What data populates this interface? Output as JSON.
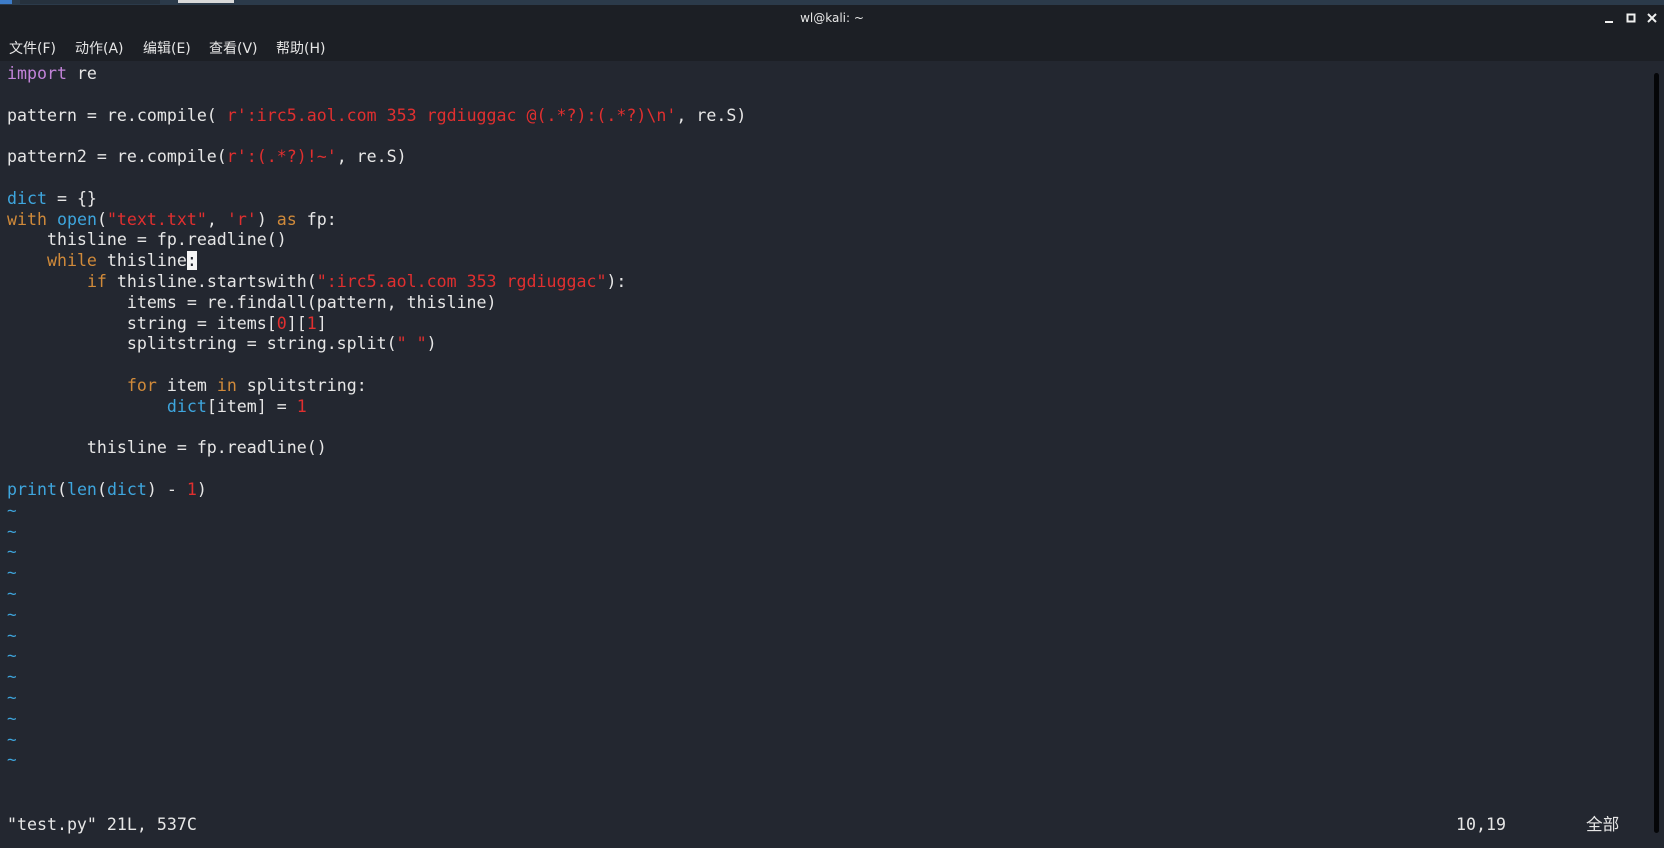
{
  "window": {
    "title": "wl@kali: ~",
    "controls": [
      "minimize-icon",
      "maximize-icon",
      "close-icon"
    ]
  },
  "menu": {
    "items": [
      "文件(F)",
      "动作(A)",
      "编辑(E)",
      "查看(V)",
      "帮助(H)"
    ]
  },
  "editor": {
    "lines": [
      [
        {
          "t": "import",
          "c": "kw"
        },
        {
          "t": " re",
          "c": "pl"
        }
      ],
      [],
      [
        {
          "t": "pattern = re.compile( ",
          "c": "pl"
        },
        {
          "t": "r':irc5.aol.com 353 rgdiuggac @(.*?):(.*?)\\n'",
          "c": "str"
        },
        {
          "t": ", re.S)",
          "c": "pl"
        }
      ],
      [],
      [
        {
          "t": "pattern2 = re.compile(",
          "c": "pl"
        },
        {
          "t": "r':(.*?)!~'",
          "c": "str"
        },
        {
          "t": ", re.S)",
          "c": "pl"
        }
      ],
      [],
      [
        {
          "t": "dict",
          "c": "bi"
        },
        {
          "t": " = {}",
          "c": "pl"
        }
      ],
      [
        {
          "t": "with",
          "c": "ctrl"
        },
        {
          "t": " ",
          "c": "pl"
        },
        {
          "t": "open",
          "c": "bi"
        },
        {
          "t": "(",
          "c": "pl"
        },
        {
          "t": "\"text.txt\"",
          "c": "str"
        },
        {
          "t": ", ",
          "c": "pl"
        },
        {
          "t": "'r'",
          "c": "str"
        },
        {
          "t": ") ",
          "c": "pl"
        },
        {
          "t": "as",
          "c": "ctrl"
        },
        {
          "t": " fp:",
          "c": "pl"
        }
      ],
      [
        {
          "t": "    thisline = fp.readline()",
          "c": "pl"
        }
      ],
      [
        {
          "t": "    ",
          "c": "pl"
        },
        {
          "t": "while",
          "c": "ctrl"
        },
        {
          "t": " thisline",
          "c": "pl"
        },
        {
          "t": ":",
          "c": "cursor"
        }
      ],
      [
        {
          "t": "        ",
          "c": "pl"
        },
        {
          "t": "if",
          "c": "ctrl"
        },
        {
          "t": " thisline.startswith(",
          "c": "pl"
        },
        {
          "t": "\":irc5.aol.com 353 rgdiuggac\"",
          "c": "str"
        },
        {
          "t": "):",
          "c": "pl"
        }
      ],
      [
        {
          "t": "            items = re.findall(pattern, thisline)",
          "c": "pl"
        }
      ],
      [
        {
          "t": "            string = items[",
          "c": "pl"
        },
        {
          "t": "0",
          "c": "num"
        },
        {
          "t": "][",
          "c": "pl"
        },
        {
          "t": "1",
          "c": "num"
        },
        {
          "t": "]",
          "c": "pl"
        }
      ],
      [
        {
          "t": "            splitstring = string.split(",
          "c": "pl"
        },
        {
          "t": "\" \"",
          "c": "str"
        },
        {
          "t": ")",
          "c": "pl"
        }
      ],
      [],
      [
        {
          "t": "            ",
          "c": "pl"
        },
        {
          "t": "for",
          "c": "ctrl"
        },
        {
          "t": " item ",
          "c": "pl"
        },
        {
          "t": "in",
          "c": "ctrl"
        },
        {
          "t": " splitstring:",
          "c": "pl"
        }
      ],
      [
        {
          "t": "                ",
          "c": "pl"
        },
        {
          "t": "dict",
          "c": "bi"
        },
        {
          "t": "[item] = ",
          "c": "pl"
        },
        {
          "t": "1",
          "c": "num"
        }
      ],
      [],
      [
        {
          "t": "        thisline = fp.readline()",
          "c": "pl"
        }
      ],
      [],
      [
        {
          "t": "print",
          "c": "bi"
        },
        {
          "t": "(",
          "c": "pl"
        },
        {
          "t": "len",
          "c": "bi"
        },
        {
          "t": "(",
          "c": "pl"
        },
        {
          "t": "dict",
          "c": "bi"
        },
        {
          "t": ") - ",
          "c": "pl"
        },
        {
          "t": "1",
          "c": "num"
        },
        {
          "t": ")",
          "c": "pl"
        }
      ]
    ],
    "tilde_char": "~",
    "tilde_count": 13
  },
  "status": {
    "file_info": "\"test.py\" 21L, 537C",
    "position": "10,19",
    "scroll": "全部"
  },
  "colors": {
    "background": "#232730",
    "titlebar": "#1c1f25",
    "keyword_import": "#c183d8",
    "keyword_control": "#d08a3a",
    "builtin": "#3ea6de",
    "string": "#e02f2f",
    "text": "#e6e6e6"
  }
}
